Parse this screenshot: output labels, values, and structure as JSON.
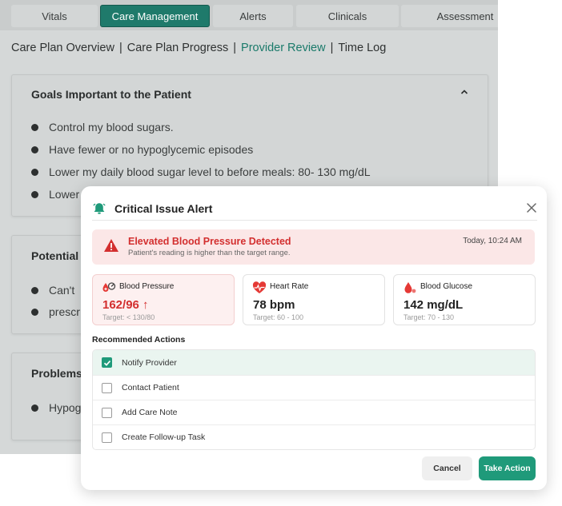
{
  "tabs": [
    {
      "label": "Vitals"
    },
    {
      "label": "Care Management"
    },
    {
      "label": "Alerts"
    },
    {
      "label": "Clinicals"
    },
    {
      "label": "Assessment"
    }
  ],
  "subnav": {
    "items": [
      "Care Plan Overview",
      "Care Plan Progress",
      "Provider Review",
      "Time Log"
    ],
    "separator": "|"
  },
  "goals_card": {
    "title": "Goals Important to the Patient",
    "items": [
      "Control my blood sugars.",
      "Have fewer or no hypoglycemic episodes",
      "Lower  my daily blood sugar level to before meals: 80- 130 mg/dL",
      "Lower"
    ]
  },
  "potential_card": {
    "title": "Potential",
    "items": [
      "Can't",
      "prescr"
    ]
  },
  "problems_card": {
    "title": "Problems",
    "items": [
      "Hypog"
    ]
  },
  "modal": {
    "title": "Critical Issue Alert",
    "alert": {
      "title": "Elevated Blood Pressure Detected",
      "subtitle": "Patient's reading is higher than the target range.",
      "time": "Today, 10:24 AM"
    },
    "metrics": [
      {
        "label": "Blood Pressure",
        "value": "162/96 ↑",
        "target": "Target: < 130/80",
        "icon": "blood-pressure-icon"
      },
      {
        "label": "Heart Rate",
        "value": "78 bpm",
        "target": "Target: 60 - 100",
        "icon": "heart-rate-icon"
      },
      {
        "label": "Blood Glucose",
        "value": "142 mg/dL",
        "target": "Target: 70 - 130",
        "icon": "blood-drop-icon"
      }
    ],
    "recommended_title": "Recommended Actions",
    "actions": [
      {
        "label": "Notify Provider",
        "checked": true
      },
      {
        "label": "Contact Patient",
        "checked": false
      },
      {
        "label": "Add Care Note",
        "checked": false
      },
      {
        "label": "Create Follow-up Task",
        "checked": false
      }
    ],
    "cancel_label": "Cancel",
    "take_action_label": "Take Action"
  },
  "colors": {
    "brand": "#1f7a6b",
    "accent": "#1f9a7a",
    "danger": "#d32f2f"
  }
}
